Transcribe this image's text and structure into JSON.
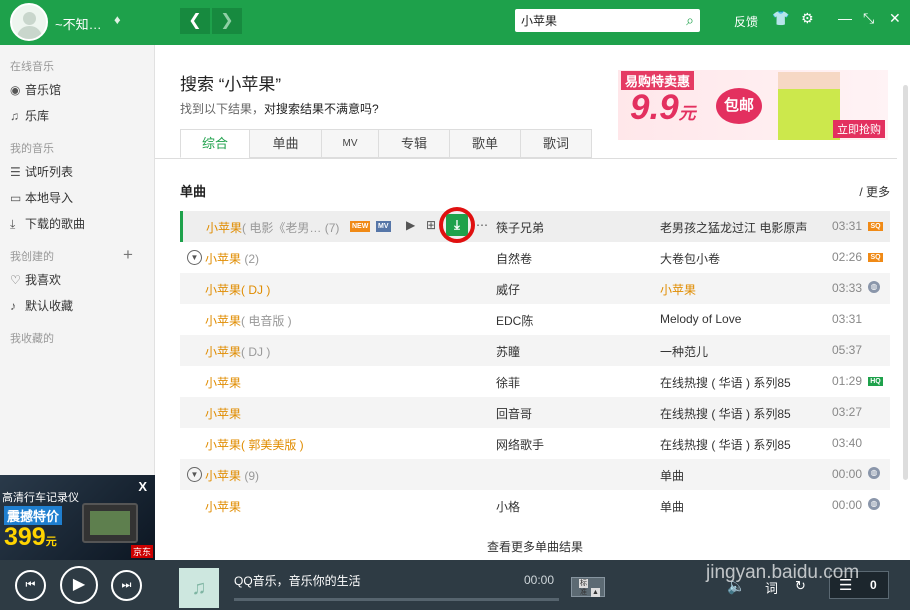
{
  "header": {
    "username": "~不知…",
    "search_value": "小苹果",
    "feedback_label": "反馈"
  },
  "sidebar": {
    "online_music_label": "在线音乐",
    "music_hall": "音乐馆",
    "library": "乐库",
    "my_music_label": "我的音乐",
    "trial_list": "试听列表",
    "local_import": "本地导入",
    "downloaded": "下载的歌曲",
    "created_label": "我创建的",
    "favorites": "我喜欢",
    "default_collection": "默认收藏",
    "collected_label": "我收藏的",
    "ad": {
      "line1": "高清行车记录仪",
      "line2": "震撼特价",
      "price": "399",
      "unit": "元",
      "close": "X",
      "shop": "京东"
    }
  },
  "main": {
    "search_title": "搜索 “小苹果”",
    "subtitle_prefix": "找到以下结果，",
    "subtitle_link": "对搜索结果不满意吗?",
    "banner": {
      "brand": "易购特卖惠",
      "price": "9.9",
      "unit": "元",
      "tag": "包邮",
      "button": "立即抢购"
    },
    "tabs": [
      "综合",
      "单曲",
      "MV",
      "专辑",
      "歌单",
      "歌词"
    ],
    "section_title": "单曲",
    "more_link": "/ 更多",
    "badge_new": "NEW",
    "badge_mv": "MV",
    "rows": [
      {
        "song": "小苹果",
        "extra": "( 电影《老男…",
        "count": "(7)",
        "artist": "筷子兄弟",
        "album": "老男孩之猛龙过江 电影原声",
        "duration": "03:31",
        "tag": "SQ"
      },
      {
        "song": "小苹果",
        "extra": "",
        "count": "(2)",
        "artist": "自然卷",
        "album": "大卷包小卷",
        "duration": "02:26",
        "tag": "SQ"
      },
      {
        "song": "小苹果",
        "extra": "( DJ )",
        "count": "",
        "artist": "威仔",
        "album": "小苹果",
        "duration": "03:33",
        "tag": "globe"
      },
      {
        "song": "小苹果",
        "extra": "( 电音版 )",
        "count": "",
        "artist": "EDC陈",
        "album": "Melody of Love",
        "duration": "03:31",
        "tag": ""
      },
      {
        "song": "小苹果",
        "extra": "( DJ )",
        "count": "",
        "artist": "苏瞳",
        "album": "一种范儿",
        "duration": "05:37",
        "tag": ""
      },
      {
        "song": "小苹果",
        "extra": "",
        "count": "",
        "artist": "徐菲",
        "album": "在线热搜 ( 华语 ) 系列85",
        "duration": "01:29",
        "tag": "HQ"
      },
      {
        "song": "小苹果",
        "extra": "",
        "count": "",
        "artist": "回音哥",
        "album": "在线热搜 ( 华语 ) 系列85",
        "duration": "03:27",
        "tag": ""
      },
      {
        "song": "小苹果",
        "extra": "( 郭美美版 )",
        "count": "",
        "artist": "网络歌手",
        "album": "在线热搜 ( 华语 ) 系列85",
        "duration": "03:40",
        "tag": ""
      },
      {
        "song": "小苹果",
        "extra": "",
        "count": "(9)",
        "artist": "",
        "album": "单曲",
        "duration": "00:00",
        "tag": "globe"
      },
      {
        "song": "小苹果",
        "extra": "",
        "count": "",
        "artist": "小格",
        "album": "单曲",
        "duration": "00:00",
        "tag": "globe"
      }
    ],
    "more_results": "查看更多单曲结果"
  },
  "player": {
    "title": "QQ音乐，音乐你的生活",
    "time": "00:00",
    "quality": "标准",
    "lyrics_label": "词",
    "playlist_count": "0"
  },
  "watermark": {
    "brand": "Bai 经验",
    "url": "jingyan.baidu.com"
  },
  "colors": {
    "brand_green": "#1ea14b",
    "song_orange": "#e08c00",
    "download_ring": "#e01010"
  }
}
